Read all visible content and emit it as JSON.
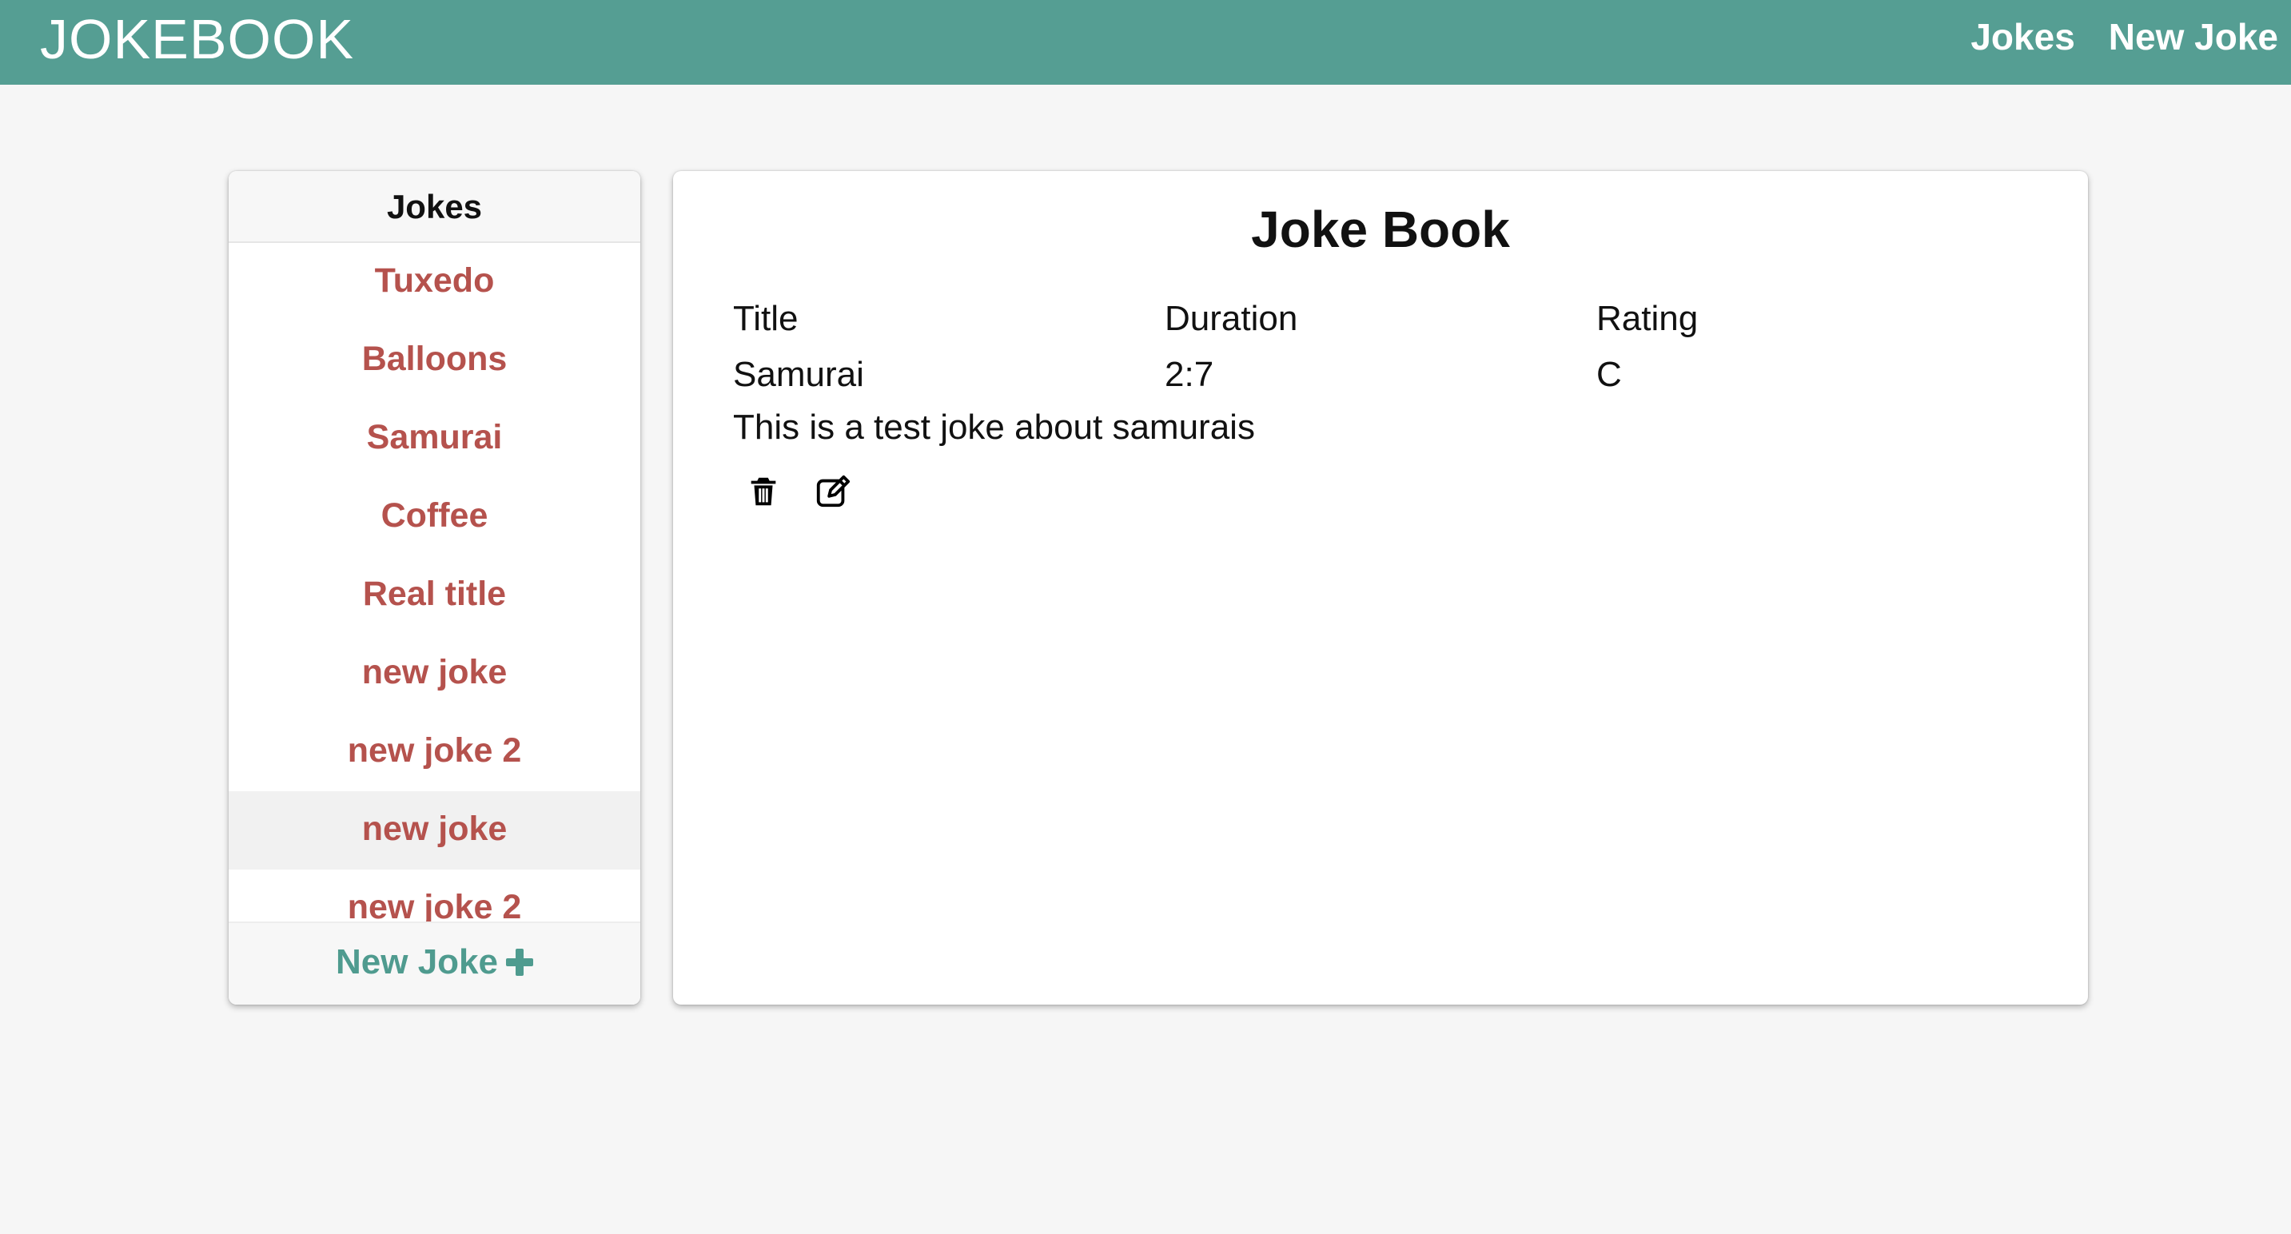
{
  "navbar": {
    "brand": "JOKEBOOK",
    "links": [
      "Jokes",
      "New Joke"
    ],
    "color": "#559e93"
  },
  "sidebar": {
    "title": "Jokes",
    "items": [
      {
        "label": "Tuxedo"
      },
      {
        "label": "Balloons"
      },
      {
        "label": "Samurai"
      },
      {
        "label": "Coffee"
      },
      {
        "label": "Real title"
      },
      {
        "label": "new joke"
      },
      {
        "label": "new joke 2"
      },
      {
        "label": "new joke",
        "selected": true
      },
      {
        "label": "new joke 2"
      }
    ],
    "footer_label": "New Joke",
    "footer_icon": "plus-icon",
    "item_color": "#b5524d",
    "footer_color": "#4f9b8f"
  },
  "main": {
    "title": "Joke Book",
    "headers": [
      "Title",
      "Duration",
      "Rating"
    ],
    "values": [
      "Samurai",
      "2:7",
      "C"
    ],
    "description": "This is a test joke about samurais",
    "actions": [
      "trash-icon",
      "edit-icon"
    ]
  }
}
